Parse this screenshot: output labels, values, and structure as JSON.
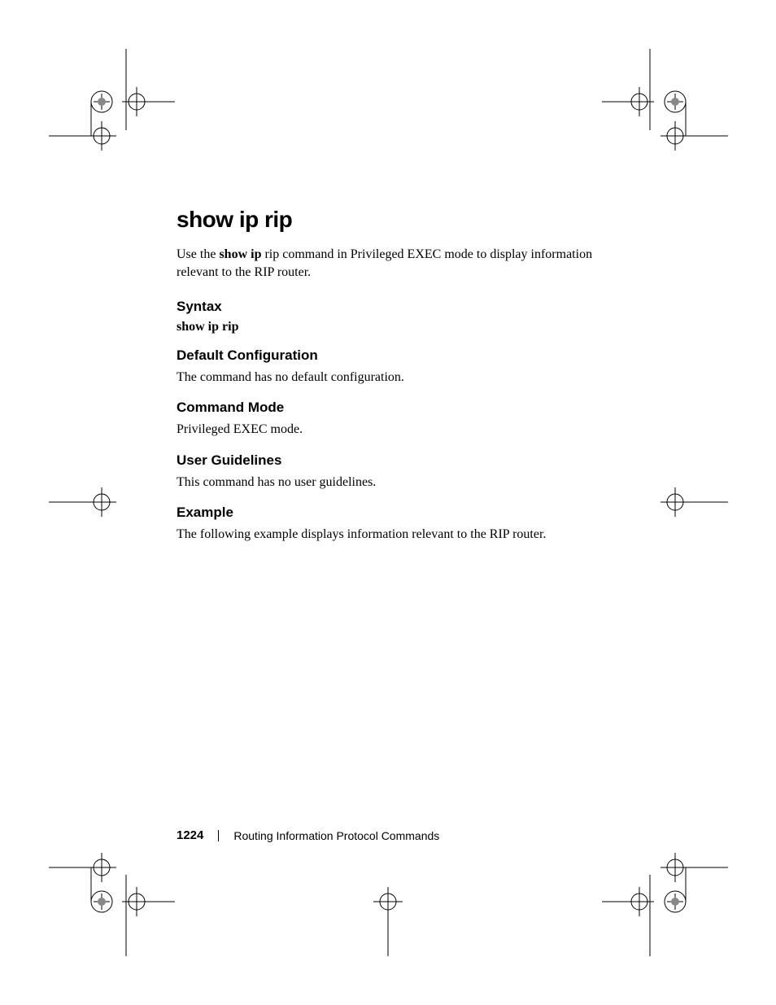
{
  "title": "show ip rip",
  "intro_prefix": "Use the ",
  "intro_bold": "show ip",
  "intro_rest": " rip command in Privileged EXEC mode to display information relevant to the RIP router.",
  "syntax_heading": "Syntax",
  "syntax_cmd": "show ip rip",
  "default_heading": "Default Configuration",
  "default_text": "The command has no default configuration.",
  "mode_heading": "Command Mode",
  "mode_text": "Privileged EXEC mode.",
  "guidelines_heading": "User Guidelines",
  "guidelines_text": "This command has no user guidelines.",
  "example_heading": "Example",
  "example_text": "The following example displays information relevant to the RIP router.",
  "page_number": "1224",
  "footer_text": "Routing Information Protocol Commands"
}
